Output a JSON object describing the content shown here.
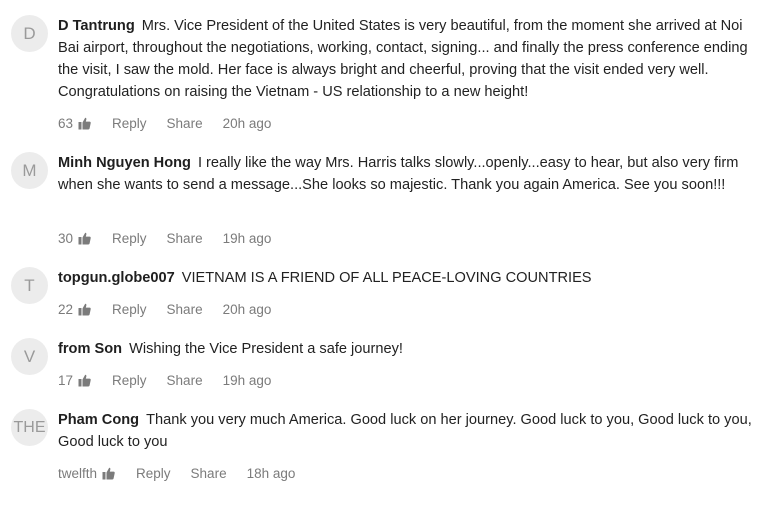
{
  "labels": {
    "reply": "Reply",
    "share": "Share"
  },
  "comments": [
    {
      "avatar": "D",
      "author": "D Tantrung",
      "text": "Mrs. Vice President of the United States is very beautiful, from the moment she arrived at Noi Bai airport, throughout the negotiations, working, contact, signing... and finally the press conference ending the visit, I saw the mold. Her face is always bright and cheerful, proving that the visit ended very well. Congratulations on raising the Vietnam - US relationship to a new height!",
      "likes": "63",
      "time": "20h ago"
    },
    {
      "avatar": "M",
      "author": "Minh Nguyen Hong",
      "text": "I really like the way Mrs. Harris talks slowly...openly...easy to hear, but also very firm when she wants to send a message...She looks so majestic. Thank you again America. See you soon!!!",
      "likes": "30",
      "time": "19h ago"
    },
    {
      "avatar": "T",
      "author": "topgun.globe007",
      "text": "VIETNAM IS A FRIEND OF ALL PEACE-LOVING COUNTRIES",
      "likes": "22",
      "time": "20h ago"
    },
    {
      "avatar": "V",
      "author": "from Son",
      "text": "Wishing the Vice President a safe journey!",
      "likes": "17",
      "time": "19h ago"
    },
    {
      "avatar": "THE",
      "author": "Pham Cong",
      "text": "Thank you very much America. Good luck on her journey. Good luck to you, Good luck to you, Good luck to you",
      "likes": "twelfth",
      "time": "18h ago"
    }
  ],
  "icons": {
    "like": "thumbs-up-icon"
  },
  "colors": {
    "avatar_bg": "#ececec",
    "avatar_text": "#9a9a9a",
    "meta_text": "#7b7b7b",
    "body_text": "#222222"
  }
}
